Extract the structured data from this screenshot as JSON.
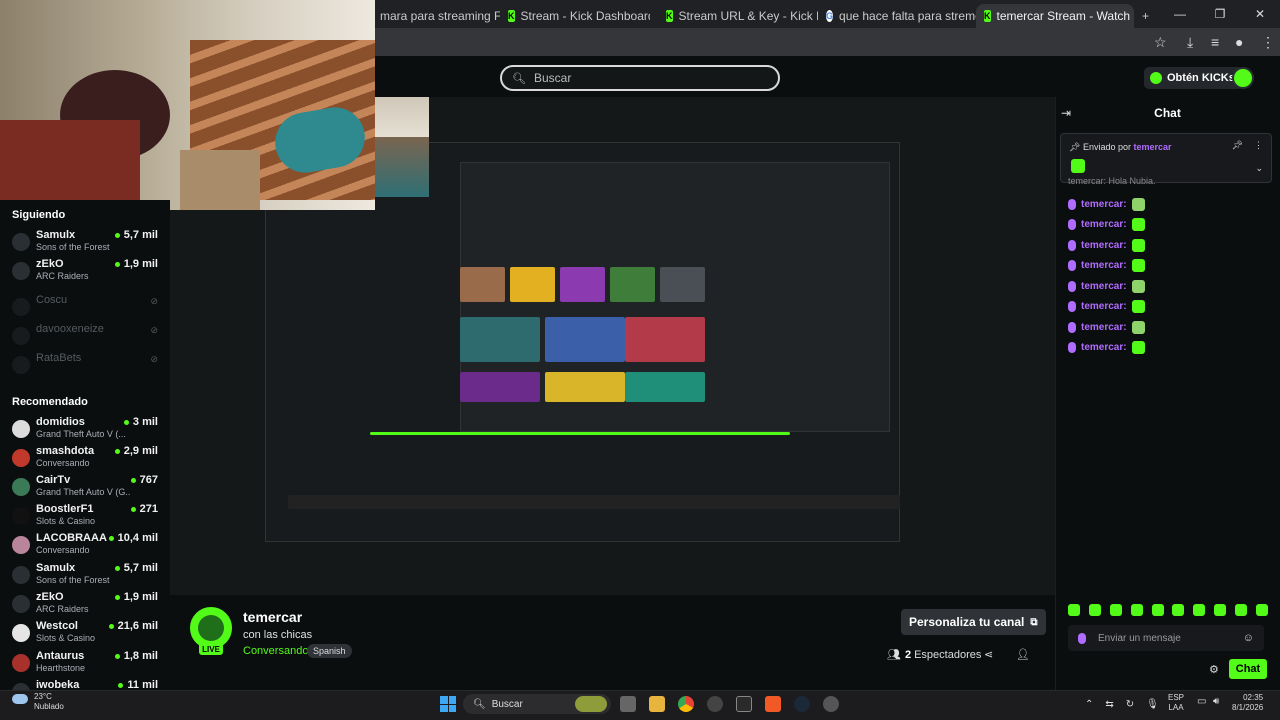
{
  "browser": {
    "tabs": [
      {
        "label": "mara para streaming FOBOS",
        "icon": "google-icon"
      },
      {
        "label": "Stream - Kick Dashboard",
        "icon": "kick-icon"
      },
      {
        "label": "Stream URL & Key - Kick Dashb",
        "icon": "kick-icon"
      },
      {
        "label": "que hace falta para stremear e",
        "icon": "google-icon"
      },
      {
        "label": "temercar Stream - Watch Live o",
        "icon": "kick-icon",
        "active": true
      }
    ],
    "new_tab": "+",
    "window_buttons": {
      "minimize": "—",
      "maximize": "❐",
      "close": "✕"
    }
  },
  "header": {
    "search_placeholder": "Buscar",
    "kicks_button": "Obtén KICKs"
  },
  "sidebar": {
    "following_heading": "Siguiendo",
    "following": [
      {
        "name": "Samulx",
        "sub": "Sons of the Forest",
        "count": "5,7 mil",
        "online": true
      },
      {
        "name": "zEkO",
        "sub": "ARC Raiders",
        "count": "1,9 mil",
        "online": true
      },
      {
        "name": "Coscu",
        "sub": "",
        "count": "",
        "online": false
      },
      {
        "name": "davooxeneize",
        "sub": "",
        "count": "",
        "online": false
      },
      {
        "name": "RataBets",
        "sub": "",
        "count": "",
        "online": false
      }
    ],
    "recommended_heading": "Recomendado",
    "recommended": [
      {
        "name": "domidios",
        "sub": "Grand Theft Auto V (...",
        "count": "3 mil"
      },
      {
        "name": "smashdota",
        "sub": "Conversando",
        "count": "2,9 mil"
      },
      {
        "name": "CairTv",
        "sub": "Grand Theft Auto V (G...",
        "count": "767"
      },
      {
        "name": "BoostlerF1",
        "sub": "Slots & Casino",
        "count": "271"
      },
      {
        "name": "LACOBRAAA",
        "sub": "Conversando",
        "count": "10,4 mil"
      },
      {
        "name": "Samulx",
        "sub": "Sons of the Forest",
        "count": "5,7 mil"
      },
      {
        "name": "zEkO",
        "sub": "ARC Raiders",
        "count": "1,9 mil"
      },
      {
        "name": "Westcol",
        "sub": "Slots & Casino",
        "count": "21,6 mil"
      },
      {
        "name": "Antaurus",
        "sub": "Hearthstone",
        "count": "1,8 mil"
      },
      {
        "name": "iwobeka",
        "sub": "",
        "count": "11 mil"
      }
    ]
  },
  "stream": {
    "streamer": "temercar",
    "title": "con las chicas",
    "category": "Conversando",
    "language": "Spanish",
    "live_badge": "LIVE",
    "customize": "Personaliza tu canal",
    "viewers_count": "2",
    "viewers_label": "Espectadores"
  },
  "chat": {
    "title": "Chat",
    "pinned_label": "Enviado por",
    "pinned_user": "temercar",
    "partial_first": "temercar: Hola Nubia.",
    "messages": [
      {
        "user": "temercar:",
        "emote": "alt"
      },
      {
        "user": "temercar:",
        "emote": "main"
      },
      {
        "user": "temercar:",
        "emote": "main"
      },
      {
        "user": "temercar:",
        "emote": "main"
      },
      {
        "user": "temercar:",
        "emote": "alt"
      },
      {
        "user": "temercar:",
        "emote": "main"
      },
      {
        "user": "temercar:",
        "emote": "alt"
      },
      {
        "user": "temercar:",
        "emote": "main"
      }
    ],
    "input_placeholder": "Enviar un mensaje",
    "send_label": "Chat"
  },
  "taskbar": {
    "weather_temp": "23°C",
    "weather_desc": "Nublado",
    "search_label": "Buscar",
    "lang_line1": "ESP",
    "lang_line2": "LAA",
    "time": "02:35",
    "date": "8/1/2026"
  }
}
